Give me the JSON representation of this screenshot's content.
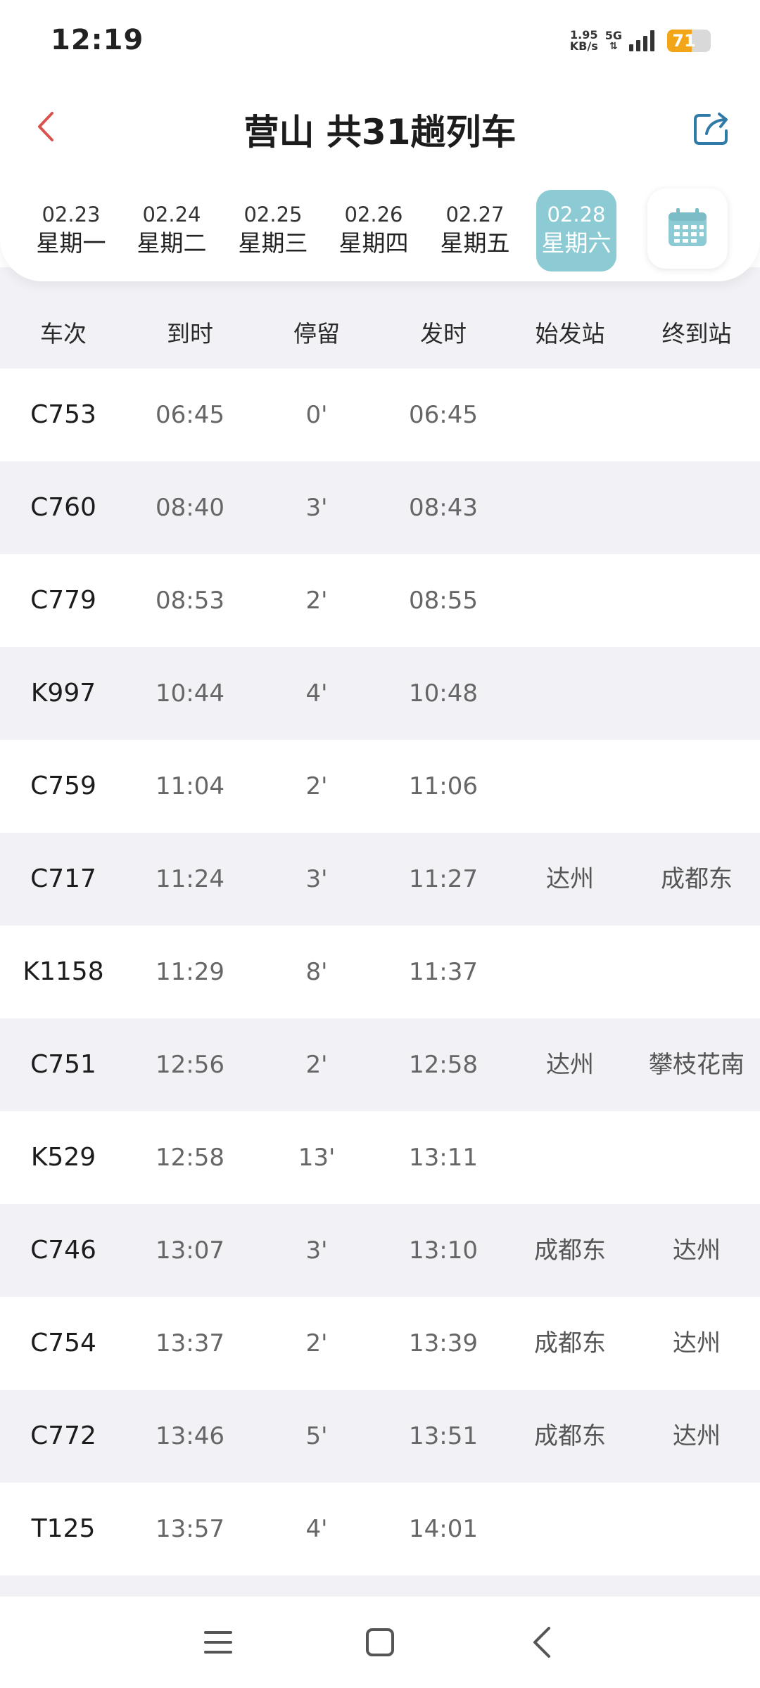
{
  "status_bar": {
    "time": "12:19",
    "net_speed_value": "1.95",
    "net_speed_unit": "KB/s",
    "network_type": "5G",
    "battery_level": "71",
    "battery_percent": 71,
    "battery_color": "#f2a516"
  },
  "header": {
    "title": "营山 共31趟列车",
    "back_icon": "chevron-left-icon",
    "share_icon": "share-icon",
    "accent_color": "#d9534f",
    "share_color": "#2f7aa6"
  },
  "dates": [
    {
      "date": "02.23",
      "weekday": "星期一",
      "active": false
    },
    {
      "date": "02.24",
      "weekday": "星期二",
      "active": false
    },
    {
      "date": "02.25",
      "weekday": "星期三",
      "active": false
    },
    {
      "date": "02.26",
      "weekday": "星期四",
      "active": false
    },
    {
      "date": "02.27",
      "weekday": "星期五",
      "active": false
    },
    {
      "date": "02.28",
      "weekday": "星期六",
      "active": true
    }
  ],
  "active_date_color": "#8ccad4",
  "calendar_icon": "calendar-icon",
  "table": {
    "columns": [
      "车次",
      "到时",
      "停留",
      "发时",
      "始发站",
      "终到站"
    ],
    "rows": [
      {
        "train": "C753",
        "arrive": "06:45",
        "stop": "0'",
        "depart": "06:45",
        "origin": "",
        "terminal": ""
      },
      {
        "train": "C760",
        "arrive": "08:40",
        "stop": "3'",
        "depart": "08:43",
        "origin": "",
        "terminal": ""
      },
      {
        "train": "C779",
        "arrive": "08:53",
        "stop": "2'",
        "depart": "08:55",
        "origin": "",
        "terminal": ""
      },
      {
        "train": "K997",
        "arrive": "10:44",
        "stop": "4'",
        "depart": "10:48",
        "origin": "",
        "terminal": ""
      },
      {
        "train": "C759",
        "arrive": "11:04",
        "stop": "2'",
        "depart": "11:06",
        "origin": "",
        "terminal": ""
      },
      {
        "train": "C717",
        "arrive": "11:24",
        "stop": "3'",
        "depart": "11:27",
        "origin": "达州",
        "terminal": "成都东"
      },
      {
        "train": "K1158",
        "arrive": "11:29",
        "stop": "8'",
        "depart": "11:37",
        "origin": "",
        "terminal": ""
      },
      {
        "train": "C751",
        "arrive": "12:56",
        "stop": "2'",
        "depart": "12:58",
        "origin": "达州",
        "terminal": "攀枝花南"
      },
      {
        "train": "K529",
        "arrive": "12:58",
        "stop": "13'",
        "depart": "13:11",
        "origin": "",
        "terminal": ""
      },
      {
        "train": "C746",
        "arrive": "13:07",
        "stop": "3'",
        "depart": "13:10",
        "origin": "成都东",
        "terminal": "达州"
      },
      {
        "train": "C754",
        "arrive": "13:37",
        "stop": "2'",
        "depart": "13:39",
        "origin": "成都东",
        "terminal": "达州"
      },
      {
        "train": "C772",
        "arrive": "13:46",
        "stop": "5'",
        "depart": "13:51",
        "origin": "成都东",
        "terminal": "达州"
      },
      {
        "train": "T125",
        "arrive": "13:57",
        "stop": "4'",
        "depart": "14:01",
        "origin": "",
        "terminal": ""
      }
    ]
  },
  "nav_bar": {
    "menu_icon": "menu-icon",
    "home_icon": "home-square-icon",
    "back_icon": "back-triangle-icon"
  }
}
